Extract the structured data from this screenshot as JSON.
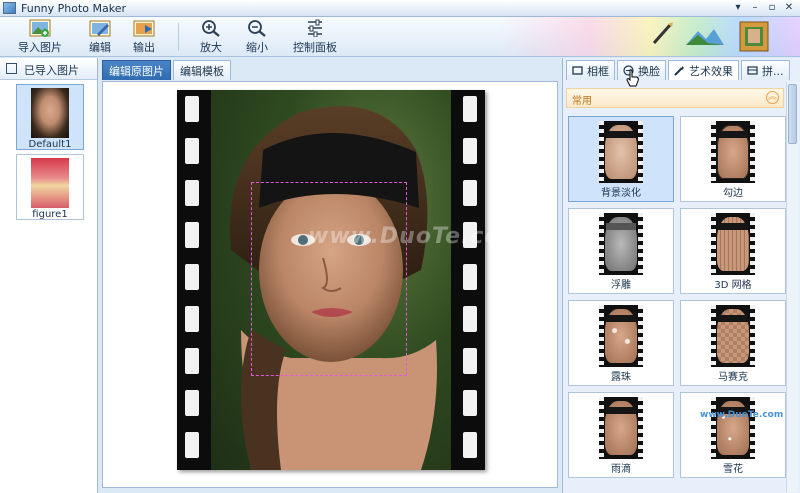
{
  "window": {
    "title": "Funny Photo Maker",
    "controls": [
      "▾",
      "–",
      "▫",
      "✕"
    ]
  },
  "toolbar": {
    "import": "导入图片",
    "edit": "编辑",
    "export": "输出",
    "zoom_in": "放大",
    "zoom_out": "缩小",
    "control_panel": "控制面板"
  },
  "left_panel": {
    "title": "已导入图片",
    "items": [
      {
        "label": "Default1",
        "selected": true
      },
      {
        "label": "figure1",
        "selected": false
      }
    ]
  },
  "center": {
    "tabs": [
      {
        "label": "编辑原图片",
        "active": true
      },
      {
        "label": "编辑模板",
        "active": false
      }
    ],
    "watermark": "www.DuoTe.com"
  },
  "right_panel": {
    "tabs": [
      {
        "label": "相框",
        "icon": "frame-icon",
        "active": false
      },
      {
        "label": "换脸",
        "icon": "face-swap-icon",
        "active": false
      },
      {
        "label": "艺术效果",
        "icon": "art-effect-icon",
        "active": true
      },
      {
        "label": "拼...",
        "icon": "collage-icon",
        "active": false
      }
    ],
    "group_title": "常用",
    "collapse_icon": "︽",
    "effects": [
      {
        "label": "背景淡化",
        "selected": true
      },
      {
        "label": "勾边",
        "selected": false
      },
      {
        "label": "浮雕",
        "selected": false
      },
      {
        "label": "3D 网格",
        "selected": false
      },
      {
        "label": "露珠",
        "selected": false
      },
      {
        "label": "马赛克",
        "selected": false
      },
      {
        "label": "雨滴",
        "selected": false
      },
      {
        "label": "雪花",
        "selected": false
      }
    ]
  },
  "corner_watermark": "www.DuoTe.com"
}
